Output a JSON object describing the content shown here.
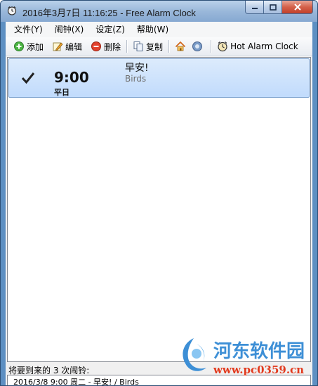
{
  "window": {
    "title": "2016年3月7日 11:16:25 - Free Alarm Clock"
  },
  "menu": [
    {
      "label": "文件(Y)"
    },
    {
      "label": "闹钟(X)"
    },
    {
      "label": "设定(Z)"
    },
    {
      "label": "帮助(W)"
    }
  ],
  "toolbar": {
    "add": "添加",
    "edit": "编辑",
    "delete": "删除",
    "copy": "复制",
    "hot_alarm_clock": "Hot Alarm Clock"
  },
  "alarms": [
    {
      "enabled": true,
      "time": "9:00",
      "days": "平日",
      "label": "早安!",
      "sound": "Birds"
    }
  ],
  "upcoming": {
    "header": "将要到来的 3 次闹铃:",
    "items": [
      "2016/3/8 9:00 周二 - 早安! / Birds"
    ]
  },
  "watermark": {
    "name": "河东软件园",
    "url": "www.pc0359.cn"
  },
  "colors": {
    "selection": "#c1dbfc",
    "watermark_blue": "#3d8fd6",
    "watermark_red": "#e23a1e"
  }
}
